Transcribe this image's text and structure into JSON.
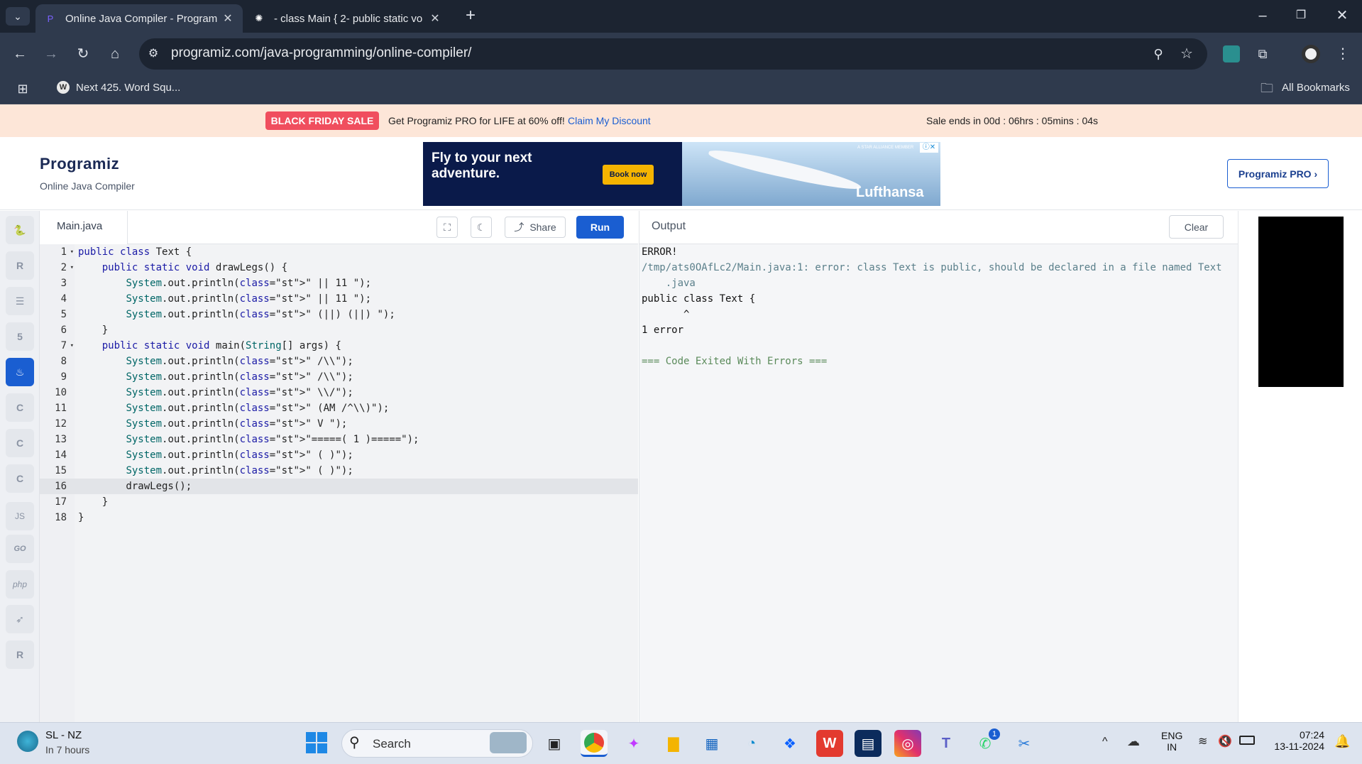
{
  "browser": {
    "tabs": [
      {
        "title": "Online Java Compiler - Program",
        "close": "✕"
      },
      {
        "title": "- class Main { 2- public static vo",
        "close": "✕"
      }
    ],
    "new_tab": "+",
    "url": "programiz.com/java-programming/online-compiler/",
    "bookmarks": [
      {
        "label": "Next 425. Word Squ..."
      }
    ],
    "all_bookmarks": "All Bookmarks"
  },
  "promo": {
    "badge": "BLACK FRIDAY SALE",
    "text": "Get Programiz PRO for LIFE at 60% off!",
    "link": "Claim My Discount",
    "timer": "Sale ends in 00d : 06hrs : 05mins : 04s"
  },
  "site": {
    "logo": "Programiz",
    "subtitle": "Online Java Compiler",
    "pro_button": "Programiz PRO ›"
  },
  "ad": {
    "headline_1": "Fly to your next",
    "headline_2": "adventure.",
    "cta": "Book now",
    "brand": "Lufthansa",
    "alliance": "A STAR ALLIANCE MEMBER"
  },
  "languages": [
    "Python",
    "R",
    "SQL",
    "HTML",
    "Java",
    "C",
    "C++",
    "C#",
    "JS",
    "GO",
    "php",
    "Swift",
    "Rust"
  ],
  "editor": {
    "file_tab": "Main.java",
    "share": "Share",
    "run": "Run",
    "lines": [
      {
        "n": "1",
        "fold": "▾"
      },
      {
        "n": "2",
        "fold": "▾"
      },
      {
        "n": "3",
        "fold": ""
      },
      {
        "n": "4",
        "fold": ""
      },
      {
        "n": "5",
        "fold": ""
      },
      {
        "n": "6",
        "fold": ""
      },
      {
        "n": "7",
        "fold": "▾"
      },
      {
        "n": "8",
        "fold": ""
      },
      {
        "n": "9",
        "fold": ""
      },
      {
        "n": "10",
        "fold": ""
      },
      {
        "n": "11",
        "fold": ""
      },
      {
        "n": "12",
        "fold": ""
      },
      {
        "n": "13",
        "fold": ""
      },
      {
        "n": "14",
        "fold": ""
      },
      {
        "n": "15",
        "fold": ""
      },
      {
        "n": "16",
        "fold": ""
      },
      {
        "n": "17",
        "fold": ""
      },
      {
        "n": "18",
        "fold": ""
      }
    ],
    "code": [
      "public class Text {",
      "    public static void drawLegs() {",
      "        System.out.println(\" || 11 \");",
      "        System.out.println(\" || 11 \");",
      "        System.out.println(\" (||) (||) \");",
      "    }",
      "    public static void main(String[] args) {",
      "        System.out.println(\" /\\\\\");",
      "        System.out.println(\" /\\\\\");",
      "        System.out.println(\" \\\\/\");",
      "        System.out.println(\" (AM /^\\\\)\");",
      "        System.out.println(\" V \");",
      "        System.out.println(\"=====( 1 )=====\");",
      "        System.out.println(\" ( )\");",
      "        System.out.println(\" ( )\");",
      "        drawLegs();",
      "    }",
      "}"
    ]
  },
  "output": {
    "title": "Output",
    "clear": "Clear",
    "lines": [
      "ERROR!",
      "/tmp/ats0OAfLc2/Main.java:1: error: class Text is public, should be declared in a file named Text",
      "    .java",
      "public class Text {",
      "       ^",
      "1 error",
      "",
      "=== Code Exited With Errors ==="
    ]
  },
  "taskbar": {
    "weather_title": "SL - NZ",
    "weather_sub": "In 7 hours",
    "search": "Search",
    "lang_1": "ENG",
    "lang_2": "IN",
    "time": "07:24",
    "date": "13-11-2024",
    "badge_count": "1"
  },
  "colors": {
    "accent": "#1a5ed1",
    "sale": "#f04e5e",
    "promo_bg": "#fde6d8",
    "chrome": "#2f3a4d"
  }
}
